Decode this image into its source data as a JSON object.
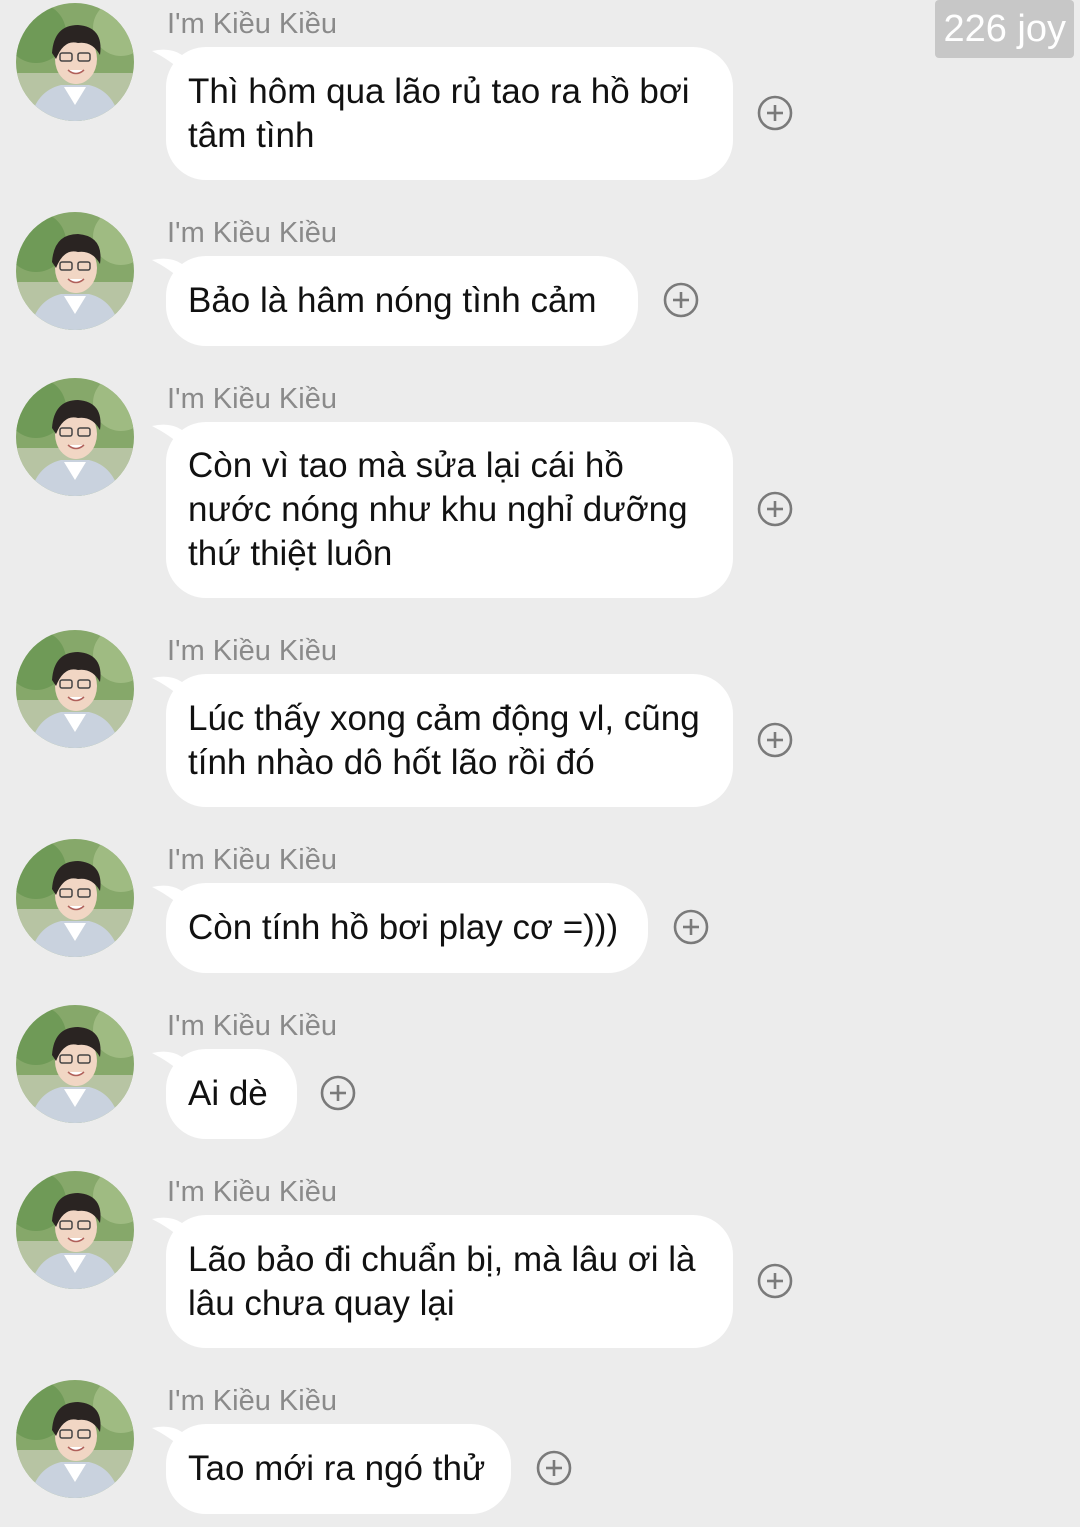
{
  "watermark": "226 joy",
  "colors": {
    "background": "#ececec",
    "bubble": "#ffffff",
    "sender_name": "#8a8a8a",
    "text": "#111111"
  },
  "messages": [
    {
      "sender": "I'm Kiều Kiều",
      "text": "Thì hôm qua lão rủ tao ra hồ bơi tâm tình",
      "reaction_icon": "plus-circle-icon"
    },
    {
      "sender": "I'm Kiều Kiều",
      "text": "Bảo là hâm nóng tình cảm",
      "reaction_icon": "plus-circle-icon"
    },
    {
      "sender": "I'm Kiều Kiều",
      "text": "Còn vì tao mà sửa lại cái hồ nước nóng như khu nghỉ dưỡng thứ thiệt luôn",
      "reaction_icon": "plus-circle-icon"
    },
    {
      "sender": "I'm Kiều Kiều",
      "text": "Lúc thấy xong cảm động vl, cũng tính nhào dô hốt lão rồi đó",
      "reaction_icon": "plus-circle-icon"
    },
    {
      "sender": "I'm Kiều Kiều",
      "text": "Còn tính hồ bơi play cơ =)))",
      "reaction_icon": "plus-circle-icon"
    },
    {
      "sender": "I'm Kiều Kiều",
      "text": "Ai dè",
      "reaction_icon": "plus-circle-icon"
    },
    {
      "sender": "I'm Kiều Kiều",
      "text": "Lão bảo đi chuẩn bị, mà lâu ơi là lâu chưa quay lại",
      "reaction_icon": "plus-circle-icon"
    },
    {
      "sender": "I'm Kiều Kiều",
      "text": "Tao mới ra ngó thử",
      "reaction_icon": "plus-circle-icon"
    }
  ]
}
